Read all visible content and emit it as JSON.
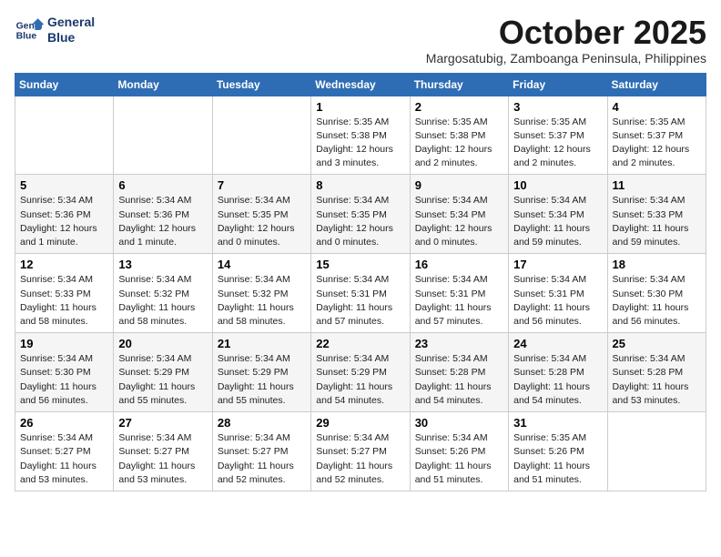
{
  "logo": {
    "line1": "General",
    "line2": "Blue"
  },
  "title": "October 2025",
  "subtitle": "Margosatubig, Zamboanga Peninsula, Philippines",
  "weekdays": [
    "Sunday",
    "Monday",
    "Tuesday",
    "Wednesday",
    "Thursday",
    "Friday",
    "Saturday"
  ],
  "weeks": [
    [
      {
        "day": "",
        "info": ""
      },
      {
        "day": "",
        "info": ""
      },
      {
        "day": "",
        "info": ""
      },
      {
        "day": "1",
        "info": "Sunrise: 5:35 AM\nSunset: 5:38 PM\nDaylight: 12 hours and 3 minutes."
      },
      {
        "day": "2",
        "info": "Sunrise: 5:35 AM\nSunset: 5:38 PM\nDaylight: 12 hours and 2 minutes."
      },
      {
        "day": "3",
        "info": "Sunrise: 5:35 AM\nSunset: 5:37 PM\nDaylight: 12 hours and 2 minutes."
      },
      {
        "day": "4",
        "info": "Sunrise: 5:35 AM\nSunset: 5:37 PM\nDaylight: 12 hours and 2 minutes."
      }
    ],
    [
      {
        "day": "5",
        "info": "Sunrise: 5:34 AM\nSunset: 5:36 PM\nDaylight: 12 hours and 1 minute."
      },
      {
        "day": "6",
        "info": "Sunrise: 5:34 AM\nSunset: 5:36 PM\nDaylight: 12 hours and 1 minute."
      },
      {
        "day": "7",
        "info": "Sunrise: 5:34 AM\nSunset: 5:35 PM\nDaylight: 12 hours and 0 minutes."
      },
      {
        "day": "8",
        "info": "Sunrise: 5:34 AM\nSunset: 5:35 PM\nDaylight: 12 hours and 0 minutes."
      },
      {
        "day": "9",
        "info": "Sunrise: 5:34 AM\nSunset: 5:34 PM\nDaylight: 12 hours and 0 minutes."
      },
      {
        "day": "10",
        "info": "Sunrise: 5:34 AM\nSunset: 5:34 PM\nDaylight: 11 hours and 59 minutes."
      },
      {
        "day": "11",
        "info": "Sunrise: 5:34 AM\nSunset: 5:33 PM\nDaylight: 11 hours and 59 minutes."
      }
    ],
    [
      {
        "day": "12",
        "info": "Sunrise: 5:34 AM\nSunset: 5:33 PM\nDaylight: 11 hours and 58 minutes."
      },
      {
        "day": "13",
        "info": "Sunrise: 5:34 AM\nSunset: 5:32 PM\nDaylight: 11 hours and 58 minutes."
      },
      {
        "day": "14",
        "info": "Sunrise: 5:34 AM\nSunset: 5:32 PM\nDaylight: 11 hours and 58 minutes."
      },
      {
        "day": "15",
        "info": "Sunrise: 5:34 AM\nSunset: 5:31 PM\nDaylight: 11 hours and 57 minutes."
      },
      {
        "day": "16",
        "info": "Sunrise: 5:34 AM\nSunset: 5:31 PM\nDaylight: 11 hours and 57 minutes."
      },
      {
        "day": "17",
        "info": "Sunrise: 5:34 AM\nSunset: 5:31 PM\nDaylight: 11 hours and 56 minutes."
      },
      {
        "day": "18",
        "info": "Sunrise: 5:34 AM\nSunset: 5:30 PM\nDaylight: 11 hours and 56 minutes."
      }
    ],
    [
      {
        "day": "19",
        "info": "Sunrise: 5:34 AM\nSunset: 5:30 PM\nDaylight: 11 hours and 56 minutes."
      },
      {
        "day": "20",
        "info": "Sunrise: 5:34 AM\nSunset: 5:29 PM\nDaylight: 11 hours and 55 minutes."
      },
      {
        "day": "21",
        "info": "Sunrise: 5:34 AM\nSunset: 5:29 PM\nDaylight: 11 hours and 55 minutes."
      },
      {
        "day": "22",
        "info": "Sunrise: 5:34 AM\nSunset: 5:29 PM\nDaylight: 11 hours and 54 minutes."
      },
      {
        "day": "23",
        "info": "Sunrise: 5:34 AM\nSunset: 5:28 PM\nDaylight: 11 hours and 54 minutes."
      },
      {
        "day": "24",
        "info": "Sunrise: 5:34 AM\nSunset: 5:28 PM\nDaylight: 11 hours and 54 minutes."
      },
      {
        "day": "25",
        "info": "Sunrise: 5:34 AM\nSunset: 5:28 PM\nDaylight: 11 hours and 53 minutes."
      }
    ],
    [
      {
        "day": "26",
        "info": "Sunrise: 5:34 AM\nSunset: 5:27 PM\nDaylight: 11 hours and 53 minutes."
      },
      {
        "day": "27",
        "info": "Sunrise: 5:34 AM\nSunset: 5:27 PM\nDaylight: 11 hours and 53 minutes."
      },
      {
        "day": "28",
        "info": "Sunrise: 5:34 AM\nSunset: 5:27 PM\nDaylight: 11 hours and 52 minutes."
      },
      {
        "day": "29",
        "info": "Sunrise: 5:34 AM\nSunset: 5:27 PM\nDaylight: 11 hours and 52 minutes."
      },
      {
        "day": "30",
        "info": "Sunrise: 5:34 AM\nSunset: 5:26 PM\nDaylight: 11 hours and 51 minutes."
      },
      {
        "day": "31",
        "info": "Sunrise: 5:35 AM\nSunset: 5:26 PM\nDaylight: 11 hours and 51 minutes."
      },
      {
        "day": "",
        "info": ""
      }
    ]
  ]
}
